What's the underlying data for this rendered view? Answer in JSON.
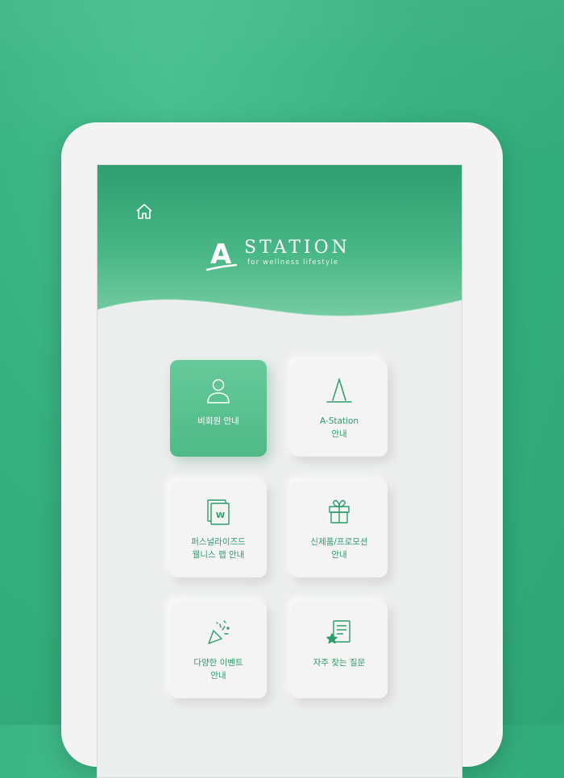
{
  "brand": {
    "logo_letter": "A",
    "title": "STATION",
    "tagline": "for wellness lifestyle"
  },
  "colors": {
    "background": "#35b07f",
    "accent": "#2d9b6c",
    "active_tile": "#5bc292"
  },
  "nav": {
    "home_icon": "home-icon"
  },
  "menu": [
    {
      "line1": "비회원 안내",
      "line2": "",
      "icon": "person-icon",
      "active": true
    },
    {
      "line1": "A-Station",
      "line2": "안내",
      "icon": "a-station-icon",
      "active": false
    },
    {
      "line1": "퍼스널라이즈드",
      "line2": "웰니스 랩 안내",
      "icon": "wellness-lab-icon",
      "active": false
    },
    {
      "line1": "신제품/프로모션",
      "line2": "안내",
      "icon": "gift-icon",
      "active": false
    },
    {
      "line1": "다양한 이벤트",
      "line2": "안내",
      "icon": "party-popper-icon",
      "active": false
    },
    {
      "line1": "자주 찾는 질문",
      "line2": "",
      "icon": "faq-icon",
      "active": false
    }
  ]
}
